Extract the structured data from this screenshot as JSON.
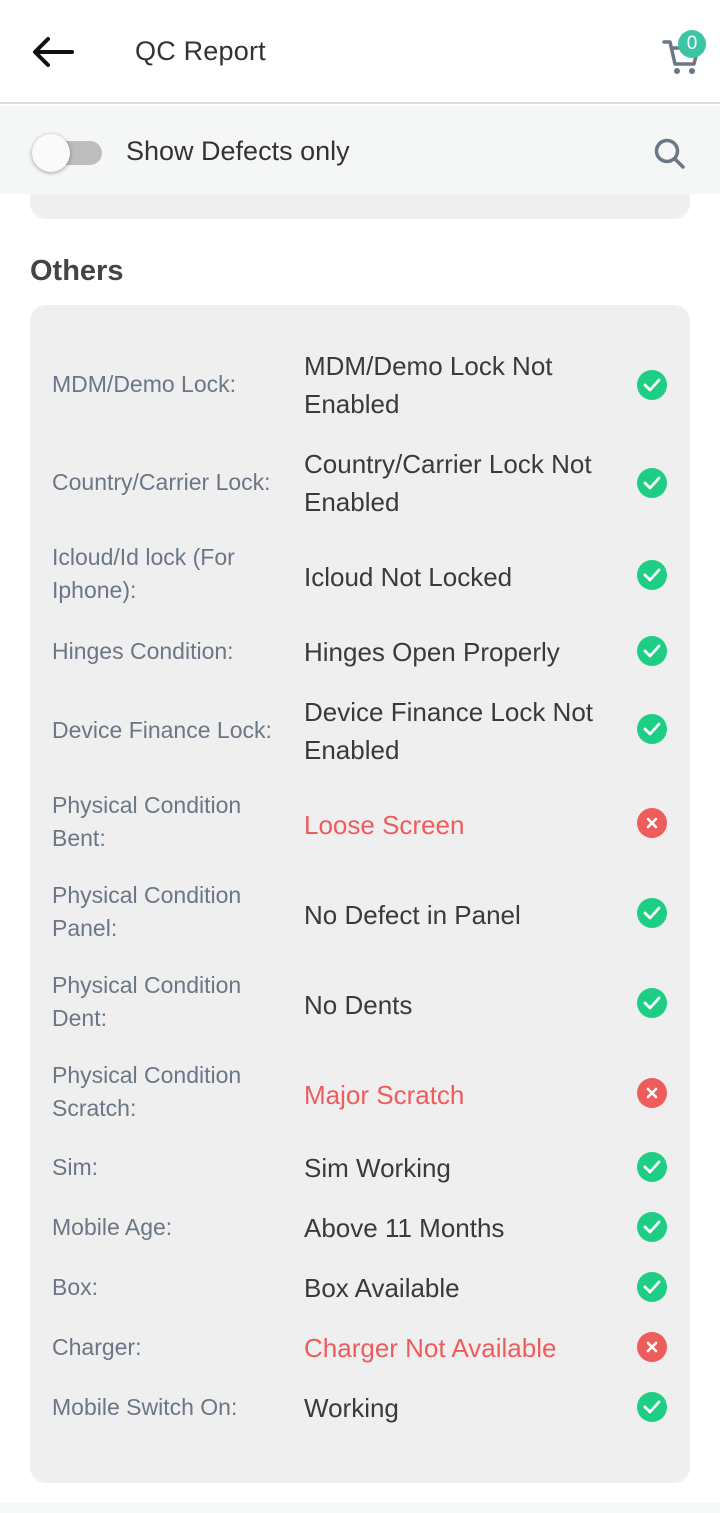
{
  "header": {
    "title": "QC Report",
    "cart_count": "0"
  },
  "filter": {
    "label": "Show Defects only",
    "enabled": false
  },
  "section": {
    "title": "Others"
  },
  "rows": [
    {
      "label": "MDM/Demo Lock:",
      "value": "MDM/Demo Lock Not Enabled",
      "status": "pass"
    },
    {
      "label": "Country/Carrier Lock:",
      "value": "Country/Carrier Lock Not Enabled",
      "status": "pass"
    },
    {
      "label": "Icloud/Id lock (For Iphone):",
      "value": "Icloud Not Locked",
      "status": "pass"
    },
    {
      "label": "Hinges Condition:",
      "value": "Hinges Open Properly",
      "status": "pass"
    },
    {
      "label": "Device Finance Lock:",
      "value": "Device Finance Lock Not Enabled",
      "status": "pass"
    },
    {
      "label": "Physical Condition Bent:",
      "value": "Loose Screen",
      "status": "fail"
    },
    {
      "label": "Physical Condition Panel:",
      "value": "No Defect in Panel",
      "status": "pass"
    },
    {
      "label": "Physical Condition Dent:",
      "value": "No Dents",
      "status": "pass"
    },
    {
      "label": "Physical Condition Scratch:",
      "value": "Major Scratch",
      "status": "fail"
    },
    {
      "label": "Sim:",
      "value": "Sim Working",
      "status": "pass"
    },
    {
      "label": "Mobile Age:",
      "value": "Above 11 Months",
      "status": "pass"
    },
    {
      "label": "Box:",
      "value": "Box Available",
      "status": "pass"
    },
    {
      "label": "Charger:",
      "value": "Charger Not Available",
      "status": "fail"
    },
    {
      "label": "Mobile Switch On:",
      "value": "Working",
      "status": "pass"
    }
  ],
  "colors": {
    "pass": "#1fce85",
    "fail": "#ef5c5c",
    "accent": "#3cc5a5"
  },
  "icons": {
    "back": "arrow-left-icon",
    "cart": "cart-icon",
    "search": "search-icon",
    "pass": "check-circle-icon",
    "fail": "x-circle-icon"
  }
}
